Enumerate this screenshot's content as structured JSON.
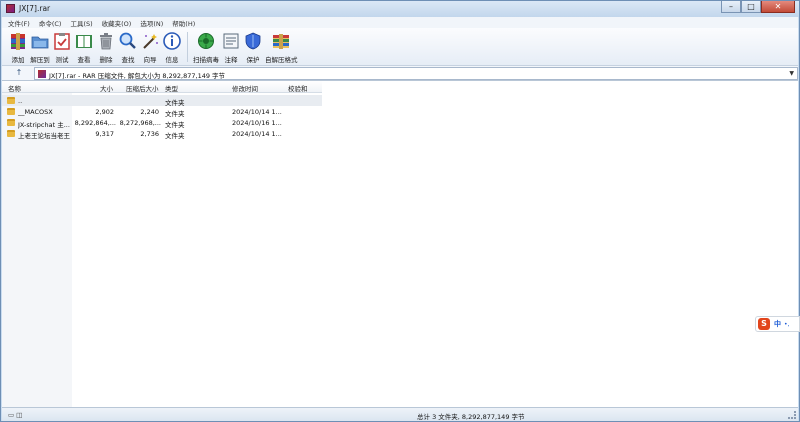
{
  "window": {
    "title": "JX[7].rar"
  },
  "menu": [
    "文件(F)",
    "命令(C)",
    "工具(S)",
    "收藏夹(O)",
    "选项(N)",
    "帮助(H)"
  ],
  "toolbar": [
    {
      "label": "添加",
      "icon": "add-archive-icon",
      "color": "#b8342c"
    },
    {
      "label": "解压到",
      "icon": "extract-folder-icon",
      "color": "#4a7cc0"
    },
    {
      "label": "测试",
      "icon": "test-clipboard-icon",
      "color": "#c83a3a"
    },
    {
      "label": "查看",
      "icon": "view-book-icon",
      "color": "#3a8a4a"
    },
    {
      "label": "删除",
      "icon": "trash-icon",
      "color": "#7a7f88"
    },
    {
      "label": "查找",
      "icon": "magnifier-icon",
      "color": "#2a6ac8"
    },
    {
      "label": "向导",
      "icon": "wizard-wand-icon",
      "color": "#8a5ac8"
    },
    {
      "label": "信息",
      "icon": "info-icon",
      "color": "#2a5ab8"
    },
    {
      "label": "扫描病毒",
      "icon": "virus-scan-icon",
      "color": "#2a9a3a"
    },
    {
      "label": "注释",
      "icon": "comment-icon",
      "color": "#5a6a7a"
    },
    {
      "label": "保护",
      "icon": "shield-icon",
      "color": "#2a5ac8"
    },
    {
      "label": "自解压格式",
      "icon": "sfx-archive-icon",
      "color": "#c87a2a"
    }
  ],
  "address": {
    "text": "JX[7].rar - RAR 压缩文件, 解包大小为 8,292,877,149 字节"
  },
  "columns": {
    "name": "名称",
    "size": "大小",
    "packed": "压缩后大小",
    "type": "类型",
    "modified": "修改时间",
    "crc": "校验和"
  },
  "rows": [
    {
      "name": "..",
      "size": "",
      "packed": "",
      "type": "文件夹",
      "modified": ""
    },
    {
      "name": "__MACOSX",
      "size": "2,902",
      "packed": "2,240",
      "type": "文件夹",
      "modified": "2024/10/14 1..."
    },
    {
      "name": "JX-stripchat 主...",
      "size": "8,292,864,...",
      "packed": "8,272,968,...",
      "type": "文件夹",
      "modified": "2024/10/16 1..."
    },
    {
      "name": "上老王论坛当老王",
      "size": "9,317",
      "packed": "2,736",
      "type": "文件夹",
      "modified": "2024/10/14 1..."
    }
  ],
  "status": {
    "text": "总计 3 文件夹, 8,292,877,149 字节"
  },
  "ime": {
    "logo": "S",
    "mode": "中"
  }
}
